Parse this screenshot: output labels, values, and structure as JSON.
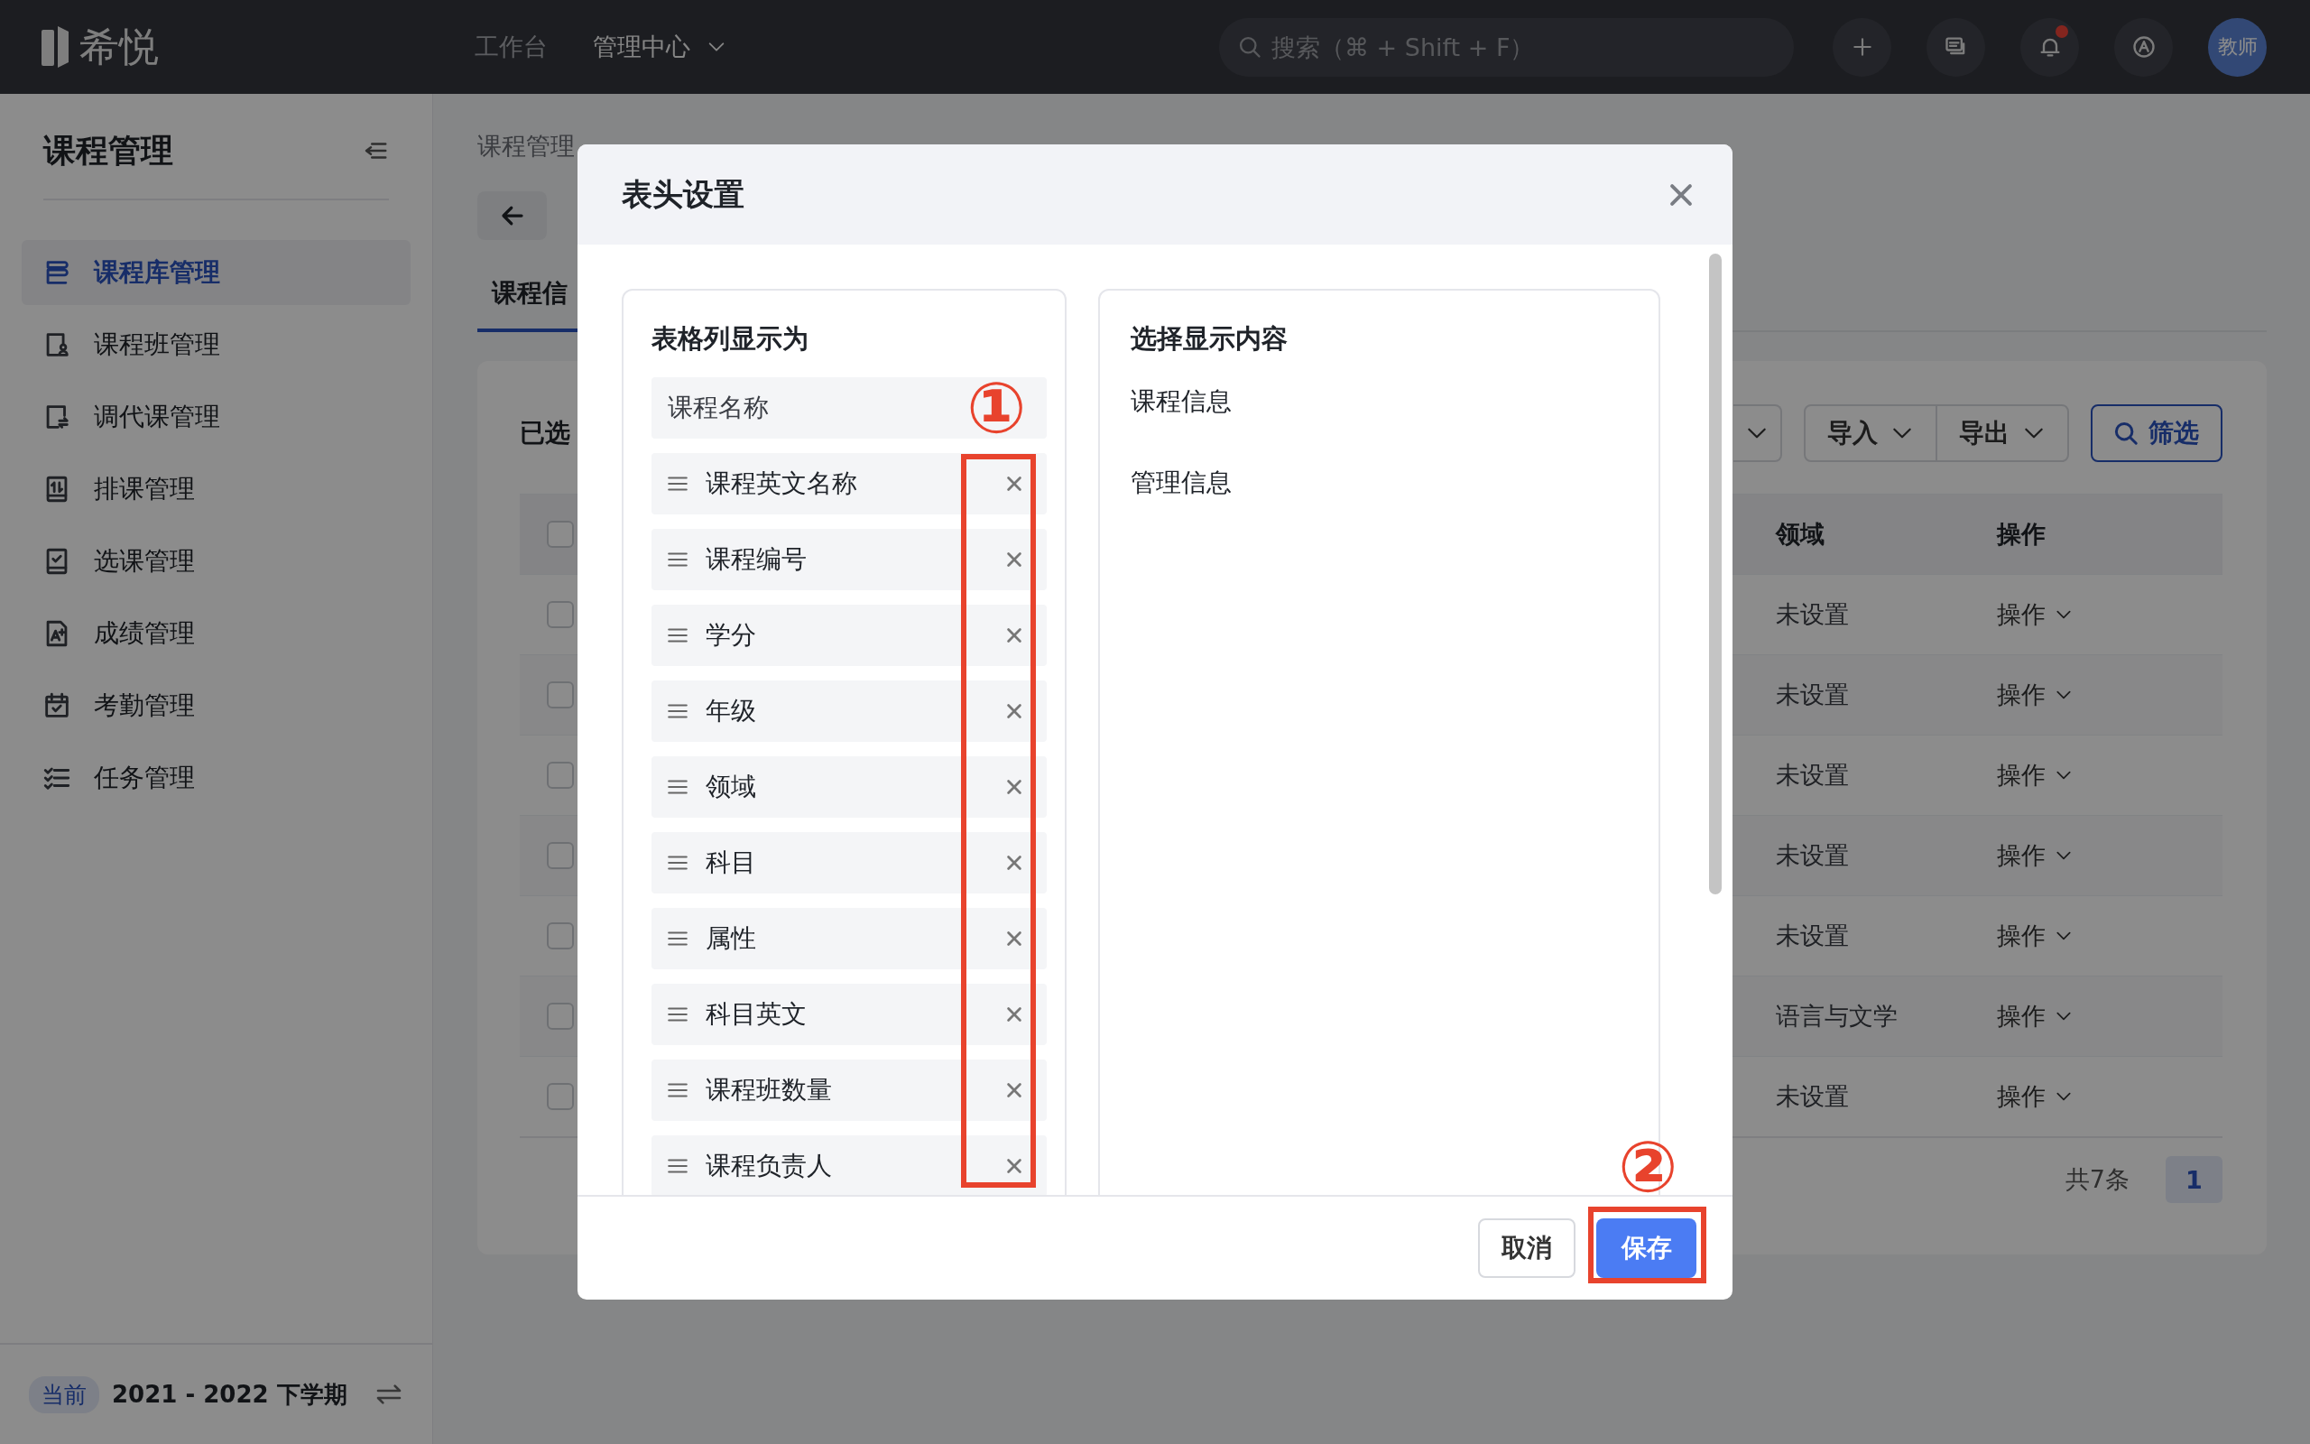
{
  "topbar": {
    "logo": "希悦",
    "nav": [
      {
        "label": "工作台",
        "selected": false,
        "kind": "link"
      },
      {
        "label": "管理中心",
        "selected": true,
        "kind": "menu"
      }
    ],
    "search": {
      "placeholder": "搜索（⌘ + Shift + F）"
    },
    "notification_dot": true,
    "avatar": "教师"
  },
  "sidebar": {
    "title": "课程管理",
    "items": [
      {
        "label": "课程库管理",
        "selected": true
      },
      {
        "label": "课程班管理",
        "selected": false
      },
      {
        "label": "调代课管理",
        "selected": false
      },
      {
        "label": "排课管理",
        "selected": false
      },
      {
        "label": "选课管理",
        "selected": false
      },
      {
        "label": "成绩管理",
        "selected": false
      },
      {
        "label": "考勤管理",
        "selected": false
      },
      {
        "label": "任务管理",
        "selected": false
      }
    ],
    "footer": {
      "badge": "当前",
      "term": "2021 - 2022 下学期"
    }
  },
  "breadcrumb": [
    "课程管理"
  ],
  "tabs": [
    {
      "label": "课程信",
      "selected": true
    }
  ],
  "content": {
    "selection_text": "已选",
    "toolbar": [
      "导入",
      "导出"
    ],
    "filter_button": "筛选",
    "table": {
      "columns": [
        "领域",
        "操作"
      ],
      "header_checked": false,
      "rows": [
        {
          "checked": false,
          "domain": "未设置",
          "action": "操作"
        },
        {
          "checked": false,
          "domain": "未设置",
          "action": "操作"
        },
        {
          "checked": false,
          "domain": "未设置",
          "action": "操作"
        },
        {
          "checked": false,
          "domain": "未设置",
          "action": "操作"
        },
        {
          "checked": false,
          "domain": "未设置",
          "action": "操作"
        },
        {
          "checked": false,
          "domain": "语言与文学",
          "action": "操作"
        },
        {
          "checked": false,
          "domain": "未设置",
          "action": "操作"
        }
      ]
    },
    "total": "共7条",
    "pages": [
      {
        "label": "1",
        "selected": true
      }
    ]
  },
  "dialog": {
    "title": "表头设置",
    "left_panel": {
      "title": "表格列显示为",
      "fixed_item": "课程名称",
      "items": [
        "课程英文名称",
        "课程编号",
        "学分",
        "年级",
        "领域",
        "科目",
        "属性",
        "科目英文",
        "课程班数量",
        "课程负责人"
      ]
    },
    "right_panel": {
      "title": "选择显示内容",
      "groups": [
        "课程信息",
        "管理信息"
      ]
    },
    "buttons": [
      {
        "label": "取消",
        "kind": "secondary"
      },
      {
        "label": "保存",
        "kind": "primary"
      }
    ],
    "annotations": [
      {
        "label": "①"
      },
      {
        "label": "②"
      }
    ]
  }
}
